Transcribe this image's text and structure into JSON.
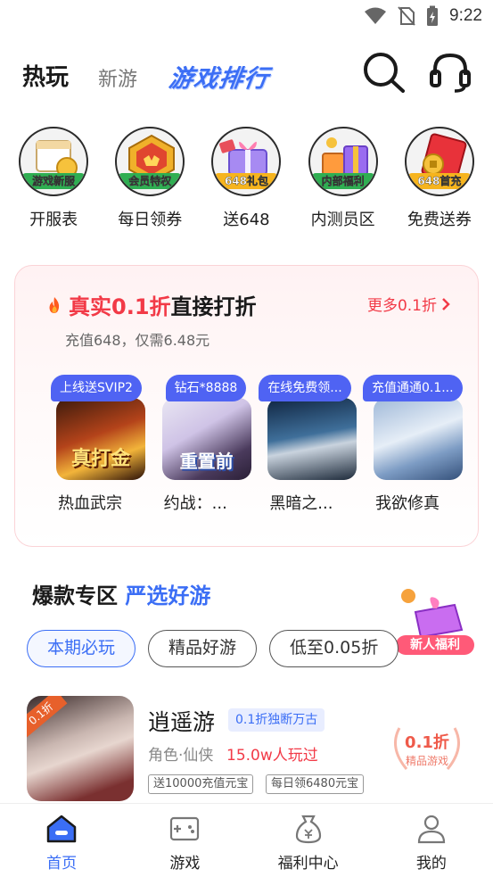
{
  "status": {
    "time": "9:22"
  },
  "header": {
    "tabs": [
      "热玩",
      "新游",
      "游戏排行"
    ]
  },
  "quick_entries": [
    {
      "ribbon": "游戏新服",
      "label": "开服表",
      "color": "#2fae52"
    },
    {
      "ribbon": "会员特权",
      "label": "每日领券",
      "color": "#2fae52"
    },
    {
      "ribbon": "648礼包",
      "label": "送648",
      "color": "#f6b41d"
    },
    {
      "ribbon": "内部福利",
      "label": "内测员区",
      "color": "#2fae52"
    },
    {
      "ribbon": "648首充",
      "label": "免费送券",
      "color": "#f6b41d"
    }
  ],
  "discount": {
    "title_red": "真实0.1折",
    "title_rest": "直接打折",
    "more": "更多0.1折",
    "subtitle": "充值648，仅需6.48元",
    "games": [
      {
        "tag": "上线送SVIP2",
        "name": "热血武宗",
        "cover_text": "真打金"
      },
      {
        "tag": "钻石*8888",
        "name": "约战：...",
        "cover_text": "重置前"
      },
      {
        "tag": "在线免费领...",
        "name": "黑暗之...",
        "cover_text": ""
      },
      {
        "tag": "充值通通0.1...",
        "name": "我欲修真",
        "cover_text": ""
      }
    ]
  },
  "hot_section": {
    "title": "爆款专区",
    "title_blue": "严选好游",
    "newbie_label": "新人福利",
    "filters": [
      "本期必玩",
      "精品好游",
      "低至0.05折"
    ]
  },
  "featured": {
    "name": "逍遥游",
    "badge": "0.1折独断万古",
    "category": "角色·仙侠",
    "players": "15.0w人玩过",
    "gifts": [
      "送10000充值元宝",
      "每日领6480元宝"
    ],
    "cover_corner": "0.1折",
    "laurel_main": "0.1折",
    "laurel_sub": "精品游戏"
  },
  "nav": {
    "items": [
      "首页",
      "游戏",
      "福利中心",
      "我的"
    ],
    "active": "首页",
    "accent": "#3b6ef5"
  }
}
